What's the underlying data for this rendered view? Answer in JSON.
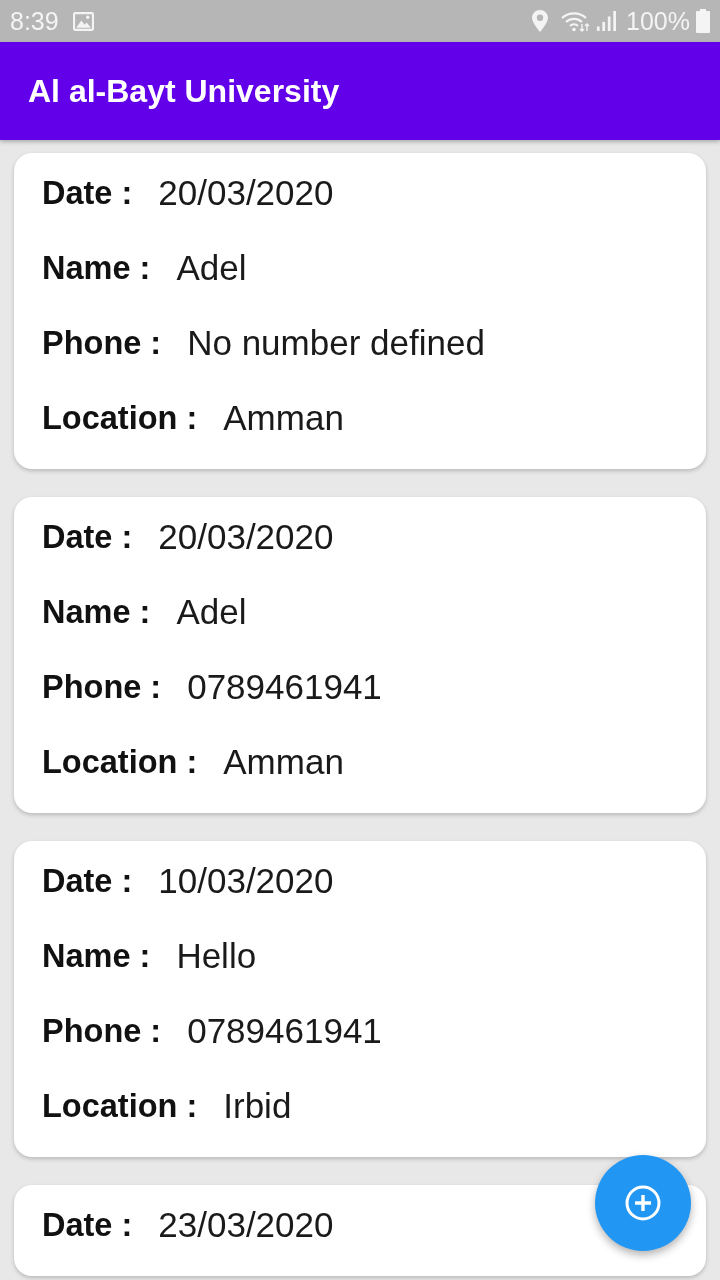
{
  "status_bar": {
    "time": "8:39",
    "battery": "100%"
  },
  "app_bar": {
    "title": "Al al-Bayt University"
  },
  "cards": [
    {
      "fields": [
        {
          "label": "Date :",
          "value": "20/03/2020"
        },
        {
          "label": "Name :",
          "value": "Adel"
        },
        {
          "label": "Phone :",
          "value": "No number defined"
        },
        {
          "label": "Location :",
          "value": "Amman"
        }
      ]
    },
    {
      "fields": [
        {
          "label": "Date :",
          "value": "20/03/2020"
        },
        {
          "label": "Name :",
          "value": "Adel"
        },
        {
          "label": "Phone :",
          "value": "0789461941"
        },
        {
          "label": "Location :",
          "value": "Amman"
        }
      ]
    },
    {
      "fields": [
        {
          "label": "Date :",
          "value": "10/03/2020"
        },
        {
          "label": "Name :",
          "value": "Hello"
        },
        {
          "label": "Phone :",
          "value": "0789461941"
        },
        {
          "label": "Location :",
          "value": "Irbid"
        }
      ]
    },
    {
      "fields": [
        {
          "label": "Date :",
          "value": "23/03/2020"
        }
      ]
    }
  ]
}
